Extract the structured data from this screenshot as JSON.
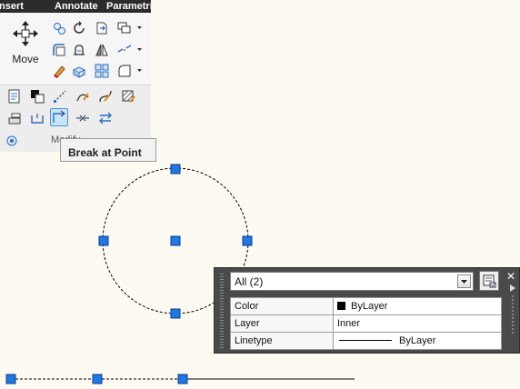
{
  "ribbon": {
    "tabs": [
      "Insert",
      "Annotate",
      "Parametric"
    ],
    "move_label": "Move",
    "panel_label": "Modify"
  },
  "tooltip": {
    "text": "Break at Point"
  },
  "quick_properties": {
    "selection": "All (2)",
    "rows": [
      {
        "property": "Color",
        "value": "ByLayer",
        "swatch": "#000000"
      },
      {
        "property": "Layer",
        "value": "Inner"
      },
      {
        "property": "Linetype",
        "value": "ByLayer"
      }
    ]
  },
  "colors": {
    "grip": "#1e78e6",
    "canvas_background": "#fdfbf1",
    "tab_bar": "#2b2b2b",
    "quick_properties_frame": "#4a4a4a"
  }
}
